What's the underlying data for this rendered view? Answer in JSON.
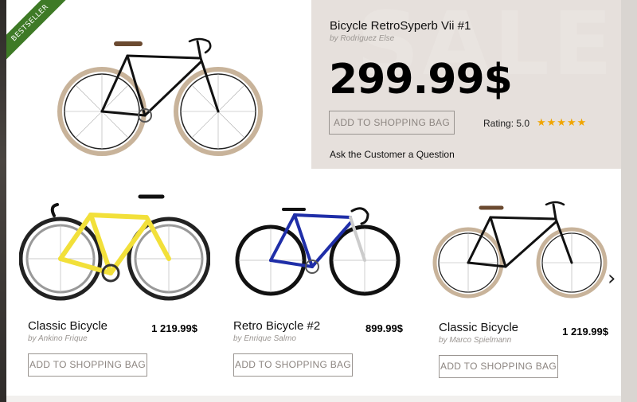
{
  "badge": "BESTSELLER",
  "feature": {
    "watermark": "SALE",
    "title": "Bicycle RetroSyperb Vii #1",
    "author": "by Rodriguez Else",
    "price": "299.99$",
    "button_label": "ADD TO SHOPPING BAG",
    "rating_text": "Rating: 5.0",
    "stars": "★★★★★",
    "rating_value": 5.0,
    "ask_link": "Ask the Customer a Question"
  },
  "products": [
    {
      "name": "Classic Bicycle",
      "author": "by Ankino Frique",
      "price": "1 219.99$",
      "button_label": "ADD TO SHOPPING BAG"
    },
    {
      "name": "Retro Bicycle #2",
      "author": "by Enrique Salmo",
      "price": "899.99$",
      "button_label": "ADD TO SHOPPING BAG"
    },
    {
      "name": "Classic Bicycle",
      "author": "by Marco Spielmann",
      "price": "1 219.99$",
      "button_label": "ADD TO SHOPPING BAG"
    }
  ],
  "next_arrow": "›",
  "colors": {
    "badge": "#3e7a26",
    "feature_bg": "#e6e0dc",
    "stars": "#f0a500"
  }
}
